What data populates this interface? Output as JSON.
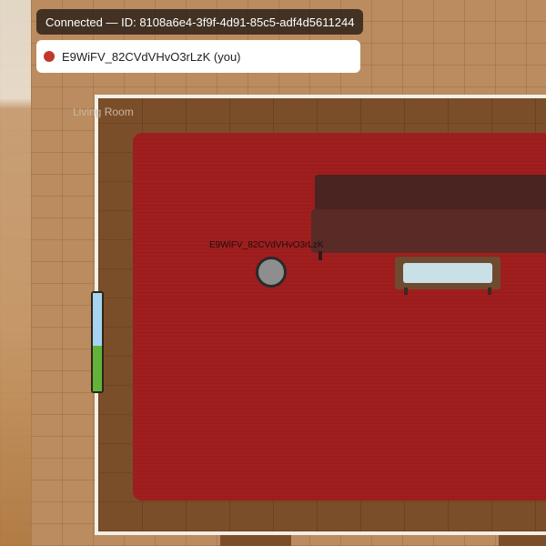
{
  "hud": {
    "connection": "Connected — ID: 8108a6e4-3f9f-4d91-85c5-adf4d5611244",
    "player_entry": {
      "name": "E9WiFV_82CVdVHvO3rLzK (you)",
      "dot_color": "#c0392b"
    }
  },
  "room": {
    "label": "Living Room"
  },
  "player": {
    "name": "E9WiFV_82CVdVHvO3rLzK"
  },
  "status_meter": {
    "level": 0.46,
    "top_color": "#a6d4f0",
    "bottom_color": "#63b23b"
  }
}
